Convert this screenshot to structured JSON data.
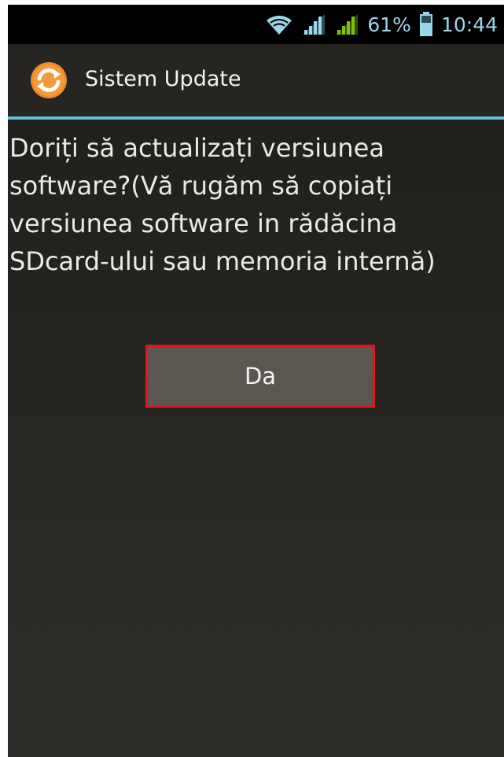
{
  "status_bar": {
    "battery_percent": "61%",
    "time": "10:44",
    "icons": [
      "wifi-icon",
      "signal-icon",
      "signal-icon",
      "battery-icon"
    ],
    "icon_color": "#9bd7ea",
    "active_signal_color": "#7cc400"
  },
  "app": {
    "title": "Sistem Update",
    "icon": "sync-icon",
    "icon_color": "#f08a2a"
  },
  "dialog": {
    "message": "Doriți să actualizați versiunea\nsoftware?(Vă rugăm să copiați\nversiunea software in rădăcina\nSDcard-ului sau memoria internă)",
    "yes_button": "Da",
    "highlight_color": "#e0161b"
  },
  "colors": {
    "accent_divider": "#64bdd6",
    "button_bg": "#5c5650"
  }
}
